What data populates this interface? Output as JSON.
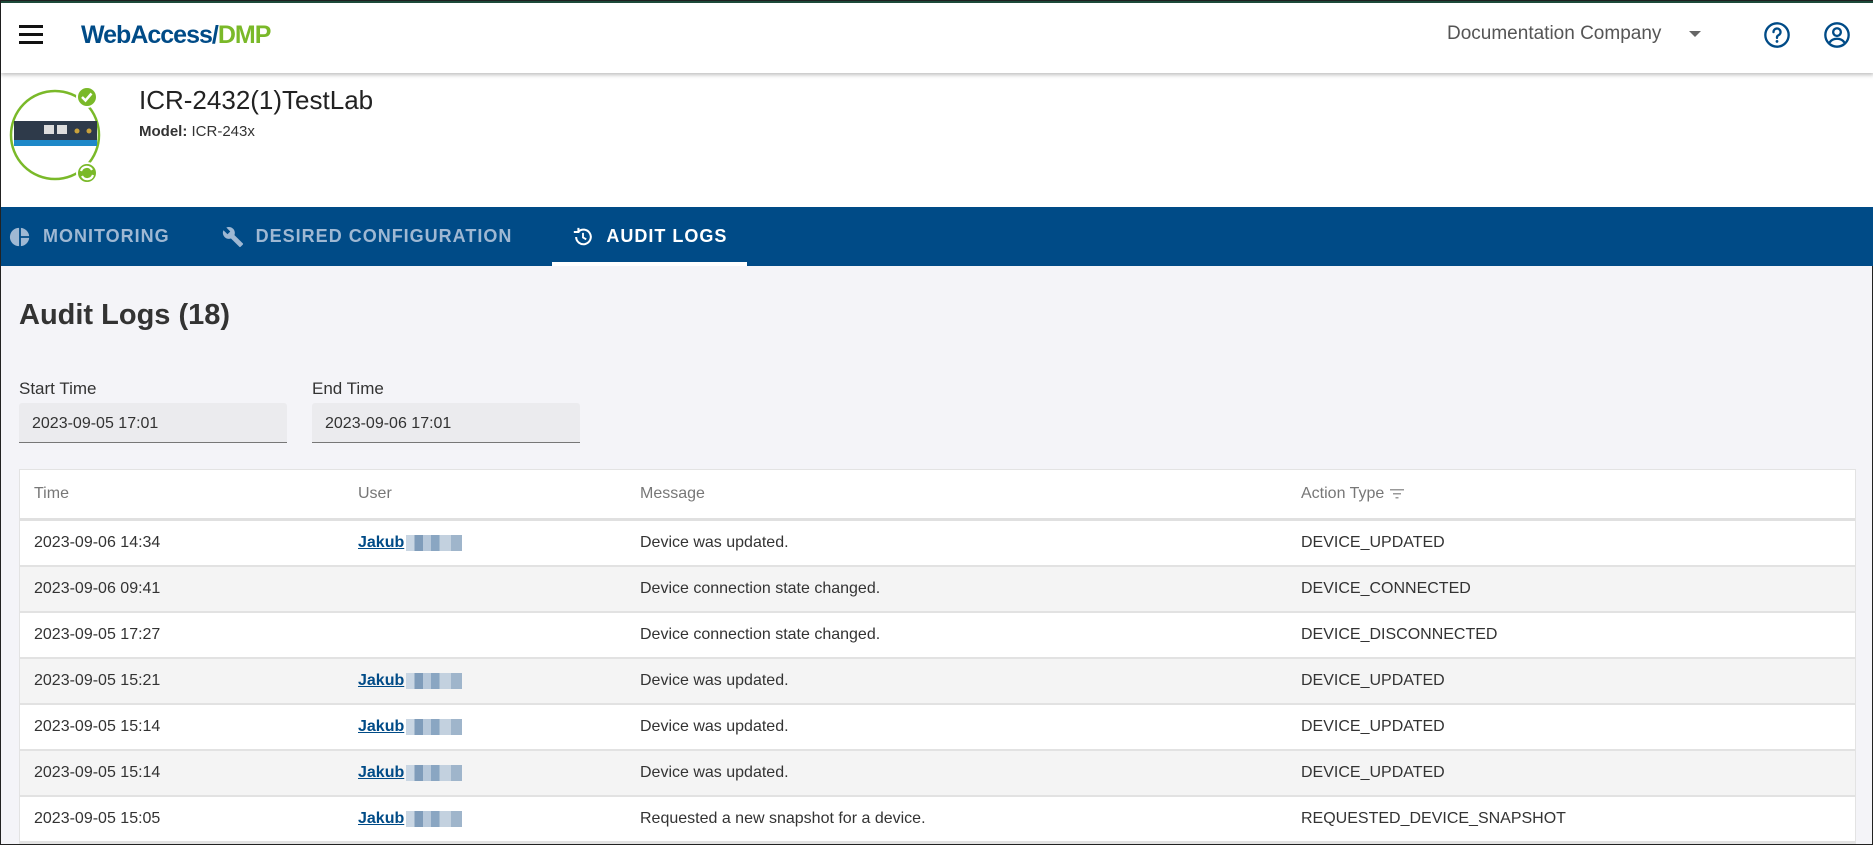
{
  "header": {
    "logo_part1": "WebAccess/",
    "logo_part2": "DMP",
    "company": "Documentation Company",
    "colors": {
      "brand_blue": "#004b87",
      "brand_green": "#7ab929"
    }
  },
  "device": {
    "name": "ICR-2432(1)TestLab",
    "model_label": "Model:",
    "model_value": "ICR-243x",
    "status_icons": [
      "check-circle-icon",
      "sync-icon"
    ]
  },
  "tabs": [
    {
      "label": "MONITORING",
      "icon": "pie-chart-icon",
      "active": false
    },
    {
      "label": "DESIRED CONFIGURATION",
      "icon": "wrench-icon",
      "active": false
    },
    {
      "label": "AUDIT LOGS",
      "icon": "history-icon",
      "active": true
    }
  ],
  "page": {
    "title": "Audit Logs (18)"
  },
  "filters": {
    "start_label": "Start Time",
    "start_value": "2023-09-05 17:01",
    "end_label": "End Time",
    "end_value": "2023-09-06 17:01"
  },
  "table": {
    "columns": [
      "Time",
      "User",
      "Message",
      "Action Type"
    ],
    "rows": [
      {
        "time": "2023-09-06 14:34",
        "user": "Jakub",
        "message": "Device was updated.",
        "action": "DEVICE_UPDATED"
      },
      {
        "time": "2023-09-06 09:41",
        "user": "",
        "message": "Device connection state changed.",
        "action": "DEVICE_CONNECTED"
      },
      {
        "time": "2023-09-05 17:27",
        "user": "",
        "message": "Device connection state changed.",
        "action": "DEVICE_DISCONNECTED"
      },
      {
        "time": "2023-09-05 15:21",
        "user": "Jakub",
        "message": "Device was updated.",
        "action": "DEVICE_UPDATED"
      },
      {
        "time": "2023-09-05 15:14",
        "user": "Jakub",
        "message": "Device was updated.",
        "action": "DEVICE_UPDATED"
      },
      {
        "time": "2023-09-05 15:14",
        "user": "Jakub",
        "message": "Device was updated.",
        "action": "DEVICE_UPDATED"
      },
      {
        "time": "2023-09-05 15:05",
        "user": "Jakub",
        "message": "Requested a new snapshot for a device.",
        "action": "REQUESTED_DEVICE_SNAPSHOT"
      }
    ]
  }
}
